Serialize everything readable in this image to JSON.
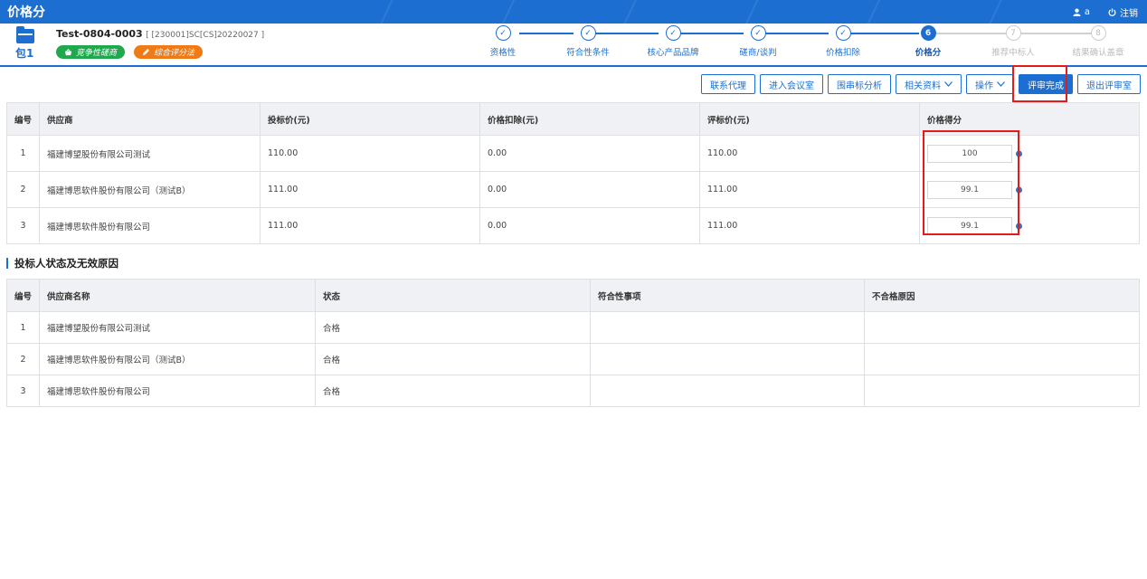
{
  "topbar": {
    "title": "价格分",
    "user": "a",
    "logout": "注销"
  },
  "package": {
    "label": "包1"
  },
  "project": {
    "name": "Test-0804-0003",
    "code": "[ [230001]SC[CS]20220027 ]",
    "tags": [
      "竞争性磋商",
      "综合评分法"
    ]
  },
  "steps": [
    {
      "label": "资格性",
      "state": "done",
      "mark": "✓"
    },
    {
      "label": "符合性条件",
      "state": "done",
      "mark": "✓"
    },
    {
      "label": "核心产品品牌",
      "state": "done",
      "mark": "✓"
    },
    {
      "label": "磋商/谈判",
      "state": "done",
      "mark": "✓"
    },
    {
      "label": "价格扣除",
      "state": "done",
      "mark": "✓"
    },
    {
      "label": "价格分",
      "state": "active",
      "mark": "6"
    },
    {
      "label": "推荐中标人",
      "state": "todo",
      "mark": "7"
    },
    {
      "label": "结果确认盖章",
      "state": "todo",
      "mark": "8"
    }
  ],
  "toolbar": {
    "contact_agent": "联系代理",
    "enter_meeting": "进入会议室",
    "collusion": "围串标分析",
    "materials": "相关资料",
    "operations": "操作",
    "finish": "评审完成",
    "exit": "退出评审室"
  },
  "price_table": {
    "headers": [
      "编号",
      "供应商",
      "投标价(元)",
      "价格扣除(元)",
      "评标价(元)",
      "价格得分"
    ],
    "rows": [
      {
        "no": "1",
        "supplier": "福建博望股份有限公司测试",
        "bid": "110.00",
        "deduction": "0.00",
        "eval": "110.00",
        "score": "100"
      },
      {
        "no": "2",
        "supplier": "福建博思软件股份有限公司（测试B）",
        "bid": "111.00",
        "deduction": "0.00",
        "eval": "111.00",
        "score": "99.1"
      },
      {
        "no": "3",
        "supplier": "福建博思软件股份有限公司",
        "bid": "111.00",
        "deduction": "0.00",
        "eval": "111.00",
        "score": "99.1"
      }
    ]
  },
  "status_section": {
    "title": "投标人状态及无效原因"
  },
  "status_table": {
    "headers": [
      "编号",
      "供应商名称",
      "状态",
      "符合性事项",
      "不合格原因"
    ],
    "rows": [
      {
        "no": "1",
        "supplier": "福建博望股份有限公司测试",
        "status": "合格",
        "compliance": "",
        "reason": ""
      },
      {
        "no": "2",
        "supplier": "福建博思软件股份有限公司（测试B）",
        "status": "合格",
        "compliance": "",
        "reason": ""
      },
      {
        "no": "3",
        "supplier": "福建博思软件股份有限公司",
        "status": "合格",
        "compliance": "",
        "reason": ""
      }
    ]
  }
}
